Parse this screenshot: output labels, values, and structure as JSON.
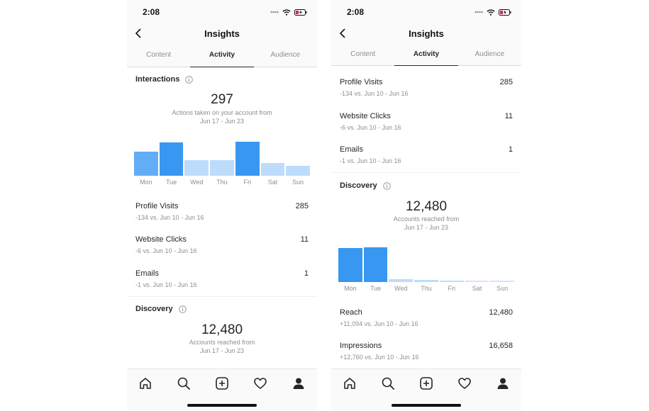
{
  "colors": {
    "bar_dark": "#3897f0",
    "bar_mid": "#62adf6",
    "bar_light": "#bddcfb",
    "bar_faint": "#cfe6fc",
    "text_primary": "#262626",
    "text_secondary": "#8e8e8e"
  },
  "left": {
    "time": "2:08",
    "title": "Insights",
    "tabs": [
      {
        "label": "Content"
      },
      {
        "label": "Activity"
      },
      {
        "label": "Audience"
      }
    ],
    "active_tab": "Activity",
    "interactions": {
      "title": "Interactions",
      "total": "297",
      "caption_line1": "Actions taken on your account from",
      "caption_line2": "Jun 17 - Jun 23"
    },
    "chart_data": {
      "type": "bar",
      "categories": [
        "Mon",
        "Tue",
        "Wed",
        "Thu",
        "Fri",
        "Sat",
        "Sun"
      ],
      "values": [
        74,
        100,
        47,
        47,
        103,
        38,
        30
      ],
      "shades": [
        "mid",
        "dark",
        "light",
        "light",
        "dark",
        "light",
        "light"
      ]
    },
    "stats": [
      {
        "label": "Profile Visits",
        "value": "285",
        "sub": "-134 vs. Jun 10 - Jun 16"
      },
      {
        "label": "Website Clicks",
        "value": "11",
        "sub": "-6 vs. Jun 10 - Jun 16"
      },
      {
        "label": "Emails",
        "value": "1",
        "sub": "-1 vs. Jun 10 - Jun 16"
      }
    ],
    "discovery": {
      "title": "Discovery",
      "total": "12,480",
      "caption_line1": "Accounts reached from",
      "caption_line2": "Jun 17 - Jun 23"
    },
    "bottom_nav": [
      "home-icon",
      "search-icon",
      "add-icon",
      "heart-icon",
      "profile-icon"
    ]
  },
  "right": {
    "time": "2:08",
    "title": "Insights",
    "tabs": [
      {
        "label": "Content"
      },
      {
        "label": "Activity"
      },
      {
        "label": "Audience"
      }
    ],
    "active_tab": "Activity",
    "stats_top": [
      {
        "label": "Profile Visits",
        "value": "285",
        "sub": "-134 vs. Jun 10 - Jun 16"
      },
      {
        "label": "Website Clicks",
        "value": "11",
        "sub": "-6 vs. Jun 10 - Jun 16"
      },
      {
        "label": "Emails",
        "value": "1",
        "sub": "-1 vs. Jun 10 - Jun 16"
      }
    ],
    "discovery": {
      "title": "Discovery",
      "total": "12,480",
      "caption_line1": "Accounts reached from",
      "caption_line2": "Jun 17 - Jun 23"
    },
    "chart_data": {
      "type": "bar",
      "categories": [
        "Mon",
        "Tue",
        "Wed",
        "Thu",
        "Fri",
        "Sat",
        "Sun"
      ],
      "values": [
        98,
        100,
        8,
        7,
        5,
        3,
        2
      ],
      "shades": [
        "dark",
        "dark",
        "light",
        "light",
        "light",
        "faint",
        "faint"
      ]
    },
    "stats_bottom": [
      {
        "label": "Reach",
        "value": "12,480",
        "sub": "+11,094 vs. Jun 10 - Jun 16"
      },
      {
        "label": "Impressions",
        "value": "16,658",
        "sub": "+12,760 vs. Jun 10 - Jun 16"
      }
    ],
    "bottom_nav": [
      "home-icon",
      "search-icon",
      "add-icon",
      "heart-icon",
      "profile-icon"
    ]
  }
}
